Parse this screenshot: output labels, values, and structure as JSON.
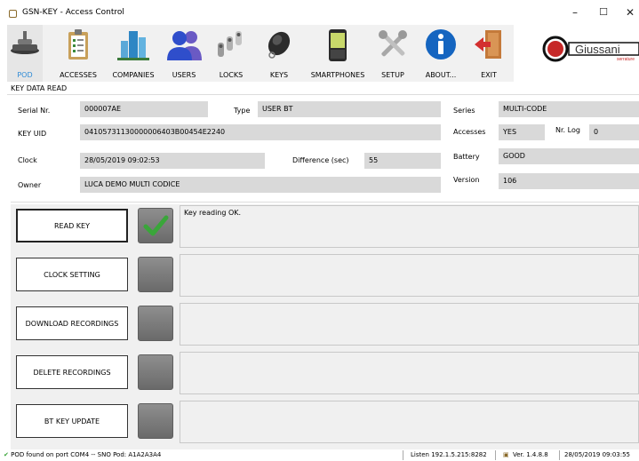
{
  "window": {
    "title": "GSN-KEY - Access Control",
    "controls": {
      "minimize": "–",
      "maximize": "☐",
      "close": "✕"
    }
  },
  "toolbar": {
    "items": [
      {
        "label": "POD",
        "icon": "pod-reader-icon",
        "active": true
      },
      {
        "label": "ACCESSES",
        "icon": "clipboard-icon"
      },
      {
        "label": "COMPANIES",
        "icon": "buildings-icon"
      },
      {
        "label": "USERS",
        "icon": "users-icon"
      },
      {
        "label": "LOCKS",
        "icon": "lock-cylinders-icon"
      },
      {
        "label": "KEYS",
        "icon": "key-fob-icon"
      },
      {
        "label": "SMARTPHONES",
        "icon": "smartphone-icon"
      },
      {
        "label": "SETUP",
        "icon": "tools-icon"
      },
      {
        "label": "ABOUT...",
        "icon": "info-icon"
      },
      {
        "label": "EXIT",
        "icon": "exit-door-icon"
      }
    ]
  },
  "logo": {
    "text": "Giussani",
    "subtext": "serrature"
  },
  "key_data": {
    "section_title": "KEY DATA READ",
    "serial_label": "Serial Nr.",
    "serial_value": "000007AE",
    "type_label": "Type",
    "type_value": "USER BT",
    "series_label": "Series",
    "series_value": "MULTI-CODE",
    "uid_label": "KEY UID",
    "uid_value": "04105731130000006403B00454E2240",
    "accesses_label": "Accesses",
    "accesses_value": "YES",
    "nrlog_label": "Nr. Log",
    "nrlog_value": "0",
    "clock_label": "Clock",
    "clock_value": "28/05/2019 09:02:53",
    "difference_label": "Difference (sec)",
    "difference_value": "55",
    "battery_label": "Battery",
    "battery_value": "GOOD",
    "owner_label": "Owner",
    "owner_value": "LUCA DEMO MULTI CODICE",
    "version_label": "Version",
    "version_value": "106"
  },
  "actions": [
    {
      "label": "READ KEY",
      "status": "ok",
      "message": "Key reading OK."
    },
    {
      "label": "CLOCK SETTING",
      "status": "idle",
      "message": ""
    },
    {
      "label": "DOWNLOAD RECORDINGS",
      "status": "idle",
      "message": ""
    },
    {
      "label": "DELETE RECORDINGS",
      "status": "idle",
      "message": ""
    },
    {
      "label": "BT KEY UPDATE",
      "status": "idle",
      "message": ""
    }
  ],
  "statusbar": {
    "pod_status": "POD found on port COM4 -- SNO Pod: A1A2A3A4",
    "listen": "Listen 192.1.5.215:8282",
    "version": "Ver. 1.4.8.8",
    "datetime": "28/05/2019 09:03:55"
  },
  "colors": {
    "active_tab": "#2e8bd6",
    "ok_check": "#3aa63a",
    "field_bg": "#d9d9d9"
  }
}
